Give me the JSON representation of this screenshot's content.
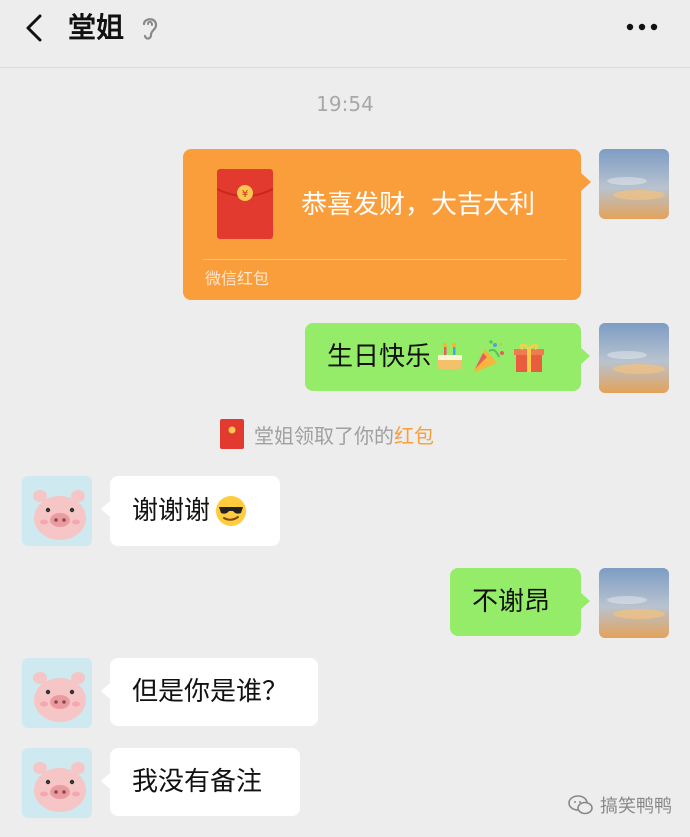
{
  "header": {
    "title": "堂姐",
    "back_icon": "chevron-left-icon",
    "mute_icon": "ear-icon",
    "more_icon": "more-dots-icon"
  },
  "timestamp": "19:54",
  "red_packet": {
    "message": "恭喜发财，大吉大利",
    "footer": "微信红包",
    "color": "#fa9d3b"
  },
  "messages": [
    {
      "from": "me",
      "text": "生日快乐",
      "emojis": [
        "cake-emoji",
        "party-popper-emoji",
        "gift-emoji"
      ]
    },
    {
      "from": "them",
      "text": "谢谢谢",
      "emojis": [
        "sunglasses-face-emoji"
      ]
    },
    {
      "from": "me",
      "text": "不谢昂"
    },
    {
      "from": "them",
      "text": "但是你是谁？"
    },
    {
      "from": "them",
      "text": "我没有备注"
    }
  ],
  "system_message": {
    "prefix": "堂姐领取了你的",
    "highlight": "红包"
  },
  "watermark": "搞笑鸭鸭",
  "colors": {
    "background": "#ededed",
    "bubble_sent": "#95ec69",
    "bubble_received": "#ffffff",
    "red_packet": "#fa9d3b",
    "highlight": "#fa9d3b"
  }
}
